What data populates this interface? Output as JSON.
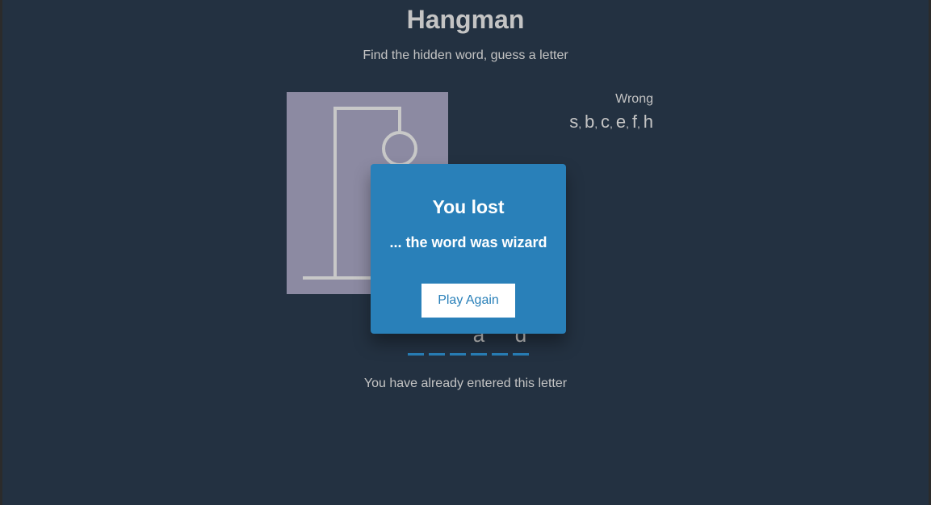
{
  "header": {
    "title": "Hangman",
    "subtitle": "Find the hidden word, guess a letter"
  },
  "wrong": {
    "label": "Wrong",
    "letters": [
      "s",
      "b",
      "c",
      "e",
      "f",
      "h"
    ]
  },
  "word": {
    "slots": [
      "",
      "",
      "",
      "a",
      "",
      "d"
    ]
  },
  "notification": {
    "text": "You have already entered this letter"
  },
  "popup": {
    "title": "You lost",
    "message": "... the word was wizard",
    "button_label": "Play Again"
  },
  "colors": {
    "background": "#233141",
    "figure_panel": "#8c8aa2",
    "accent": "#2980b9",
    "text": "#c4c4c4"
  }
}
